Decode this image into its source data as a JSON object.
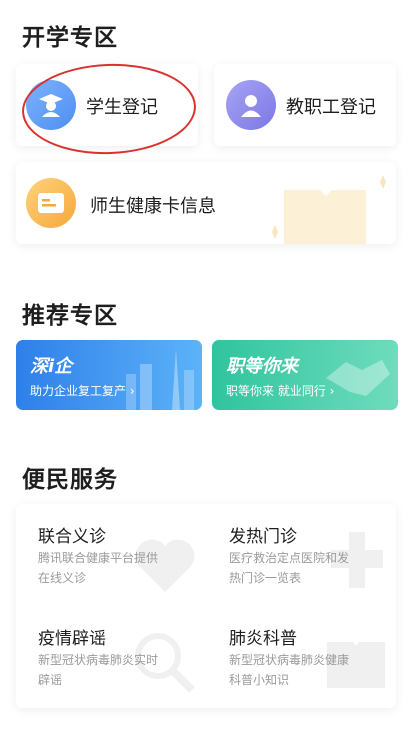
{
  "sections": {
    "kaixue": "开学专区",
    "tuijian": "推荐专区",
    "bianmin": "便民服务"
  },
  "kaixue": {
    "student": "学生登记",
    "staff": "教职工登记",
    "health": "师生健康卡信息"
  },
  "tuijian": {
    "card1": {
      "title": "深i企",
      "sub": "助力企业复工复产 ›"
    },
    "card2": {
      "title": "职等你来",
      "sub": "职等你来 就业同行 ›"
    }
  },
  "services": [
    {
      "title": "联合义诊",
      "desc": "腾讯联合健康平台提供在线义诊"
    },
    {
      "title": "发热门诊",
      "desc": "医疗救治定点医院和发热门诊一览表"
    },
    {
      "title": "疫情辟谣",
      "desc": "新型冠状病毒肺炎实时辟谣"
    },
    {
      "title": "肺炎科普",
      "desc": "新型冠状病毒肺炎健康科普小知识"
    }
  ],
  "colors": {
    "student_icon": "#5b9bf5",
    "staff_icon": "#8a86ea",
    "health_icon": "#f7b54b",
    "promo1": "#3a8ef2",
    "promo2": "#38c9a6",
    "annotation": "#d9322f"
  },
  "icons": {
    "student": "graduate-icon",
    "staff": "person-icon",
    "health": "id-card-icon"
  }
}
